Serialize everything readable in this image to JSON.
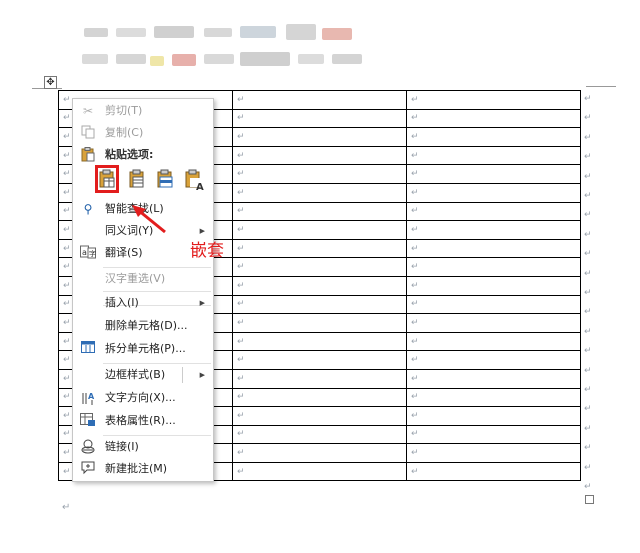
{
  "context_menu": {
    "cut": "剪切(T)",
    "copy": "复制(C)",
    "paste_heading": "粘贴选项:",
    "paste_option_letter": "A",
    "smart_lookup": "智能查找(L)",
    "synonyms": "同义词(Y)",
    "translate": "翻译(S)",
    "hanzi_reselect": "汉字重选(V)",
    "insert": "插入(I)",
    "delete_cells": "删除单元格(D)...",
    "split_cells": "拆分单元格(P)...",
    "border_style": "边框样式(B)",
    "text_direction": "文字方向(X)...",
    "table_properties": "表格属性(R)...",
    "link": "链接(I)",
    "new_comment": "新建批注(M)"
  },
  "annotation": {
    "callout_text": "嵌套",
    "color": "#e21d1d"
  },
  "table": {
    "rows": 21,
    "cols": 3,
    "cell_mark": "↵"
  },
  "end_mark": "↵",
  "icons": [
    "scissors-icon",
    "copy-icon",
    "paste-icon",
    "search-icon",
    "translate-icon",
    "split-cells-icon",
    "text-direction-icon",
    "table-properties-icon",
    "link-icon",
    "comment-icon",
    "chevron-right-icon",
    "move-handle-icon"
  ]
}
